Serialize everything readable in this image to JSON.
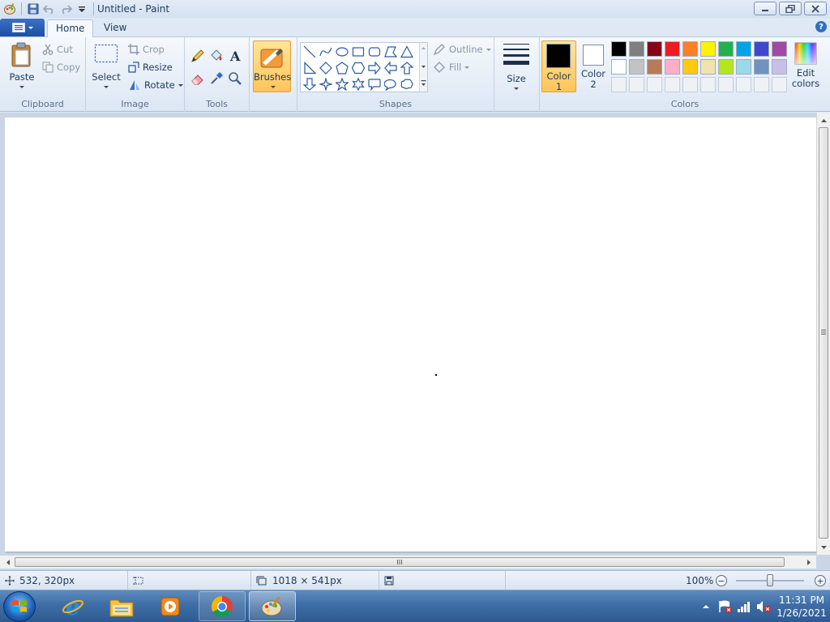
{
  "window": {
    "title": "Untitled - Paint"
  },
  "tabs": [
    {
      "label": "Home",
      "active": true
    },
    {
      "label": "View",
      "active": false
    }
  ],
  "ribbon": {
    "clipboard": {
      "group_label": "Clipboard",
      "paste": "Paste",
      "cut": "Cut",
      "copy": "Copy"
    },
    "image": {
      "group_label": "Image",
      "select": "Select",
      "crop": "Crop",
      "resize": "Resize",
      "rotate": "Rotate"
    },
    "tools": {
      "group_label": "Tools"
    },
    "brushes": {
      "label": "Brushes"
    },
    "shapes": {
      "group_label": "Shapes",
      "outline": "Outline",
      "fill": "Fill"
    },
    "size": {
      "label": "Size"
    },
    "colors": {
      "group_label": "Colors",
      "color1_line1": "Color",
      "color1_line2": "1",
      "color2_line1": "Color",
      "color2_line2": "2",
      "edit_line1": "Edit",
      "edit_line2": "colors",
      "color1_value": "#000000",
      "color2_value": "#ffffff",
      "palette_row1": [
        "#000000",
        "#7f7f7f",
        "#880015",
        "#ed1c24",
        "#ff7f27",
        "#fff200",
        "#22b14c",
        "#00a2e8",
        "#3f48cc",
        "#a349a4"
      ],
      "palette_row2": [
        "#ffffff",
        "#c3c3c3",
        "#b97a57",
        "#ffaec9",
        "#ffc90e",
        "#efe4b0",
        "#b5e61d",
        "#99d9ea",
        "#7092be",
        "#c8bfe7"
      ]
    }
  },
  "status": {
    "cursor_pos": "532, 320px",
    "canvas_size": "1018 × 541px",
    "zoom": "100%"
  },
  "taskbar": {
    "time": "11:31 PM",
    "date": "1/26/2021"
  }
}
